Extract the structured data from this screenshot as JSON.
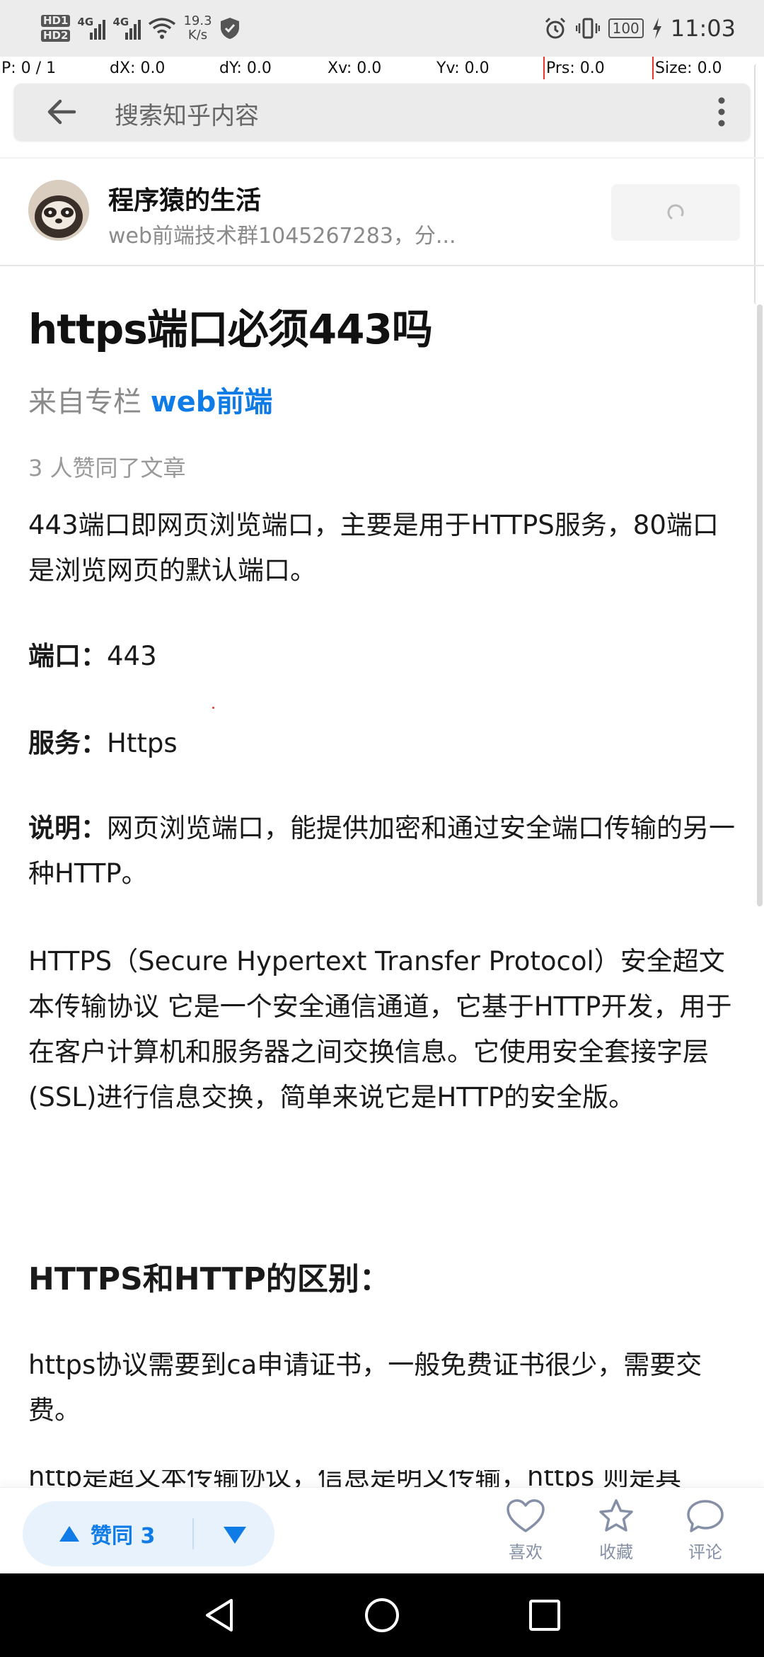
{
  "status_bar": {
    "hd1": "HD1",
    "hd2": "HD2",
    "net1": "4G",
    "net2": "4G",
    "speed_value": "19.3",
    "speed_unit": "K/s",
    "battery": "100",
    "time": "11:03"
  },
  "debug_overlay": {
    "p": "P: 0 / 1",
    "dx": "dX: 0.0",
    "dy": "dY: 0.0",
    "xv": "Xv: 0.0",
    "yv": "Yv: 0.0",
    "prs": "Prs: 0.0",
    "size": "Size: 0.0"
  },
  "search": {
    "placeholder": "搜索知乎内容"
  },
  "author": {
    "name": "程序猿的生活",
    "bio": "web前端技术群1045267283，分..."
  },
  "article": {
    "title": "https端口必须443吗",
    "column_prefix": "来自专栏 ",
    "column_name": "web前端",
    "likes_text": "3 人赞同了文章",
    "p1": "443端口即网页浏览端口，主要是用于HTTPS服务，80端口是浏览网页的默认端口。",
    "port_label": "端口：",
    "port_value": "443",
    "service_label": "服务：",
    "service_value": "Https",
    "desc_label": "说明：",
    "desc_value": "网页浏览端口，能提供加密和通过安全端口传输的另一种HTTP。",
    "p2": "HTTPS（Secure Hypertext Transfer Protocol）安全超文本传输协议 它是一个安全通信通道，它基于HTTP开发，用于在客户计算机和服务器之间交换信息。它使用安全套接字层(SSL)进行信息交换，简单来说它是HTTP的安全版。",
    "section_heading": "HTTPS和HTTP的区别：",
    "p3": "https协议需要到ca申请证书，一般免费证书很少，需要交费。",
    "p4_cut": "http是超文本传输协议，信息是明文传输，https 则是具"
  },
  "actions": {
    "vote_up": "赞同 3",
    "like": "喜欢",
    "favorite": "收藏",
    "comment": "评论"
  },
  "colors": {
    "accent": "#0e7be6",
    "vote_bg": "#e8f2fd",
    "muted": "#8590a6"
  }
}
